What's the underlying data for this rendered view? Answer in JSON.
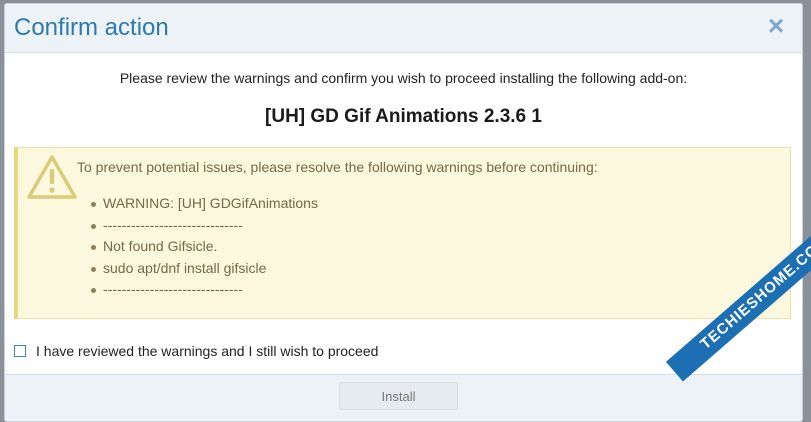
{
  "dialog": {
    "title": "Confirm action",
    "close_symbol": "×",
    "intro": "Please review the warnings and confirm you wish to proceed installing the following add-on:",
    "addon_name": "[UH] GD Gif Animations 2.3.6 1"
  },
  "warnings": {
    "icon": "warning-triangle-icon",
    "lead": "To prevent potential issues, please resolve the following warnings before continuing:",
    "items": [
      "WARNING: [UH] GDGifAnimations",
      "------------------------------",
      "Not found Gifsicle.",
      "sudo apt/dnf install gifsicle",
      "------------------------------"
    ]
  },
  "confirm": {
    "label": "I have reviewed the warnings and I still wish to proceed",
    "checked": false
  },
  "footer": {
    "install_label": "Install"
  },
  "watermark": {
    "text": "TECHIESHOME.COM"
  },
  "colors": {
    "title": "#2b7bb0",
    "header_bg": "#edf2f7",
    "warning_bg": "#fbf8dd",
    "warning_text": "#75694a"
  }
}
